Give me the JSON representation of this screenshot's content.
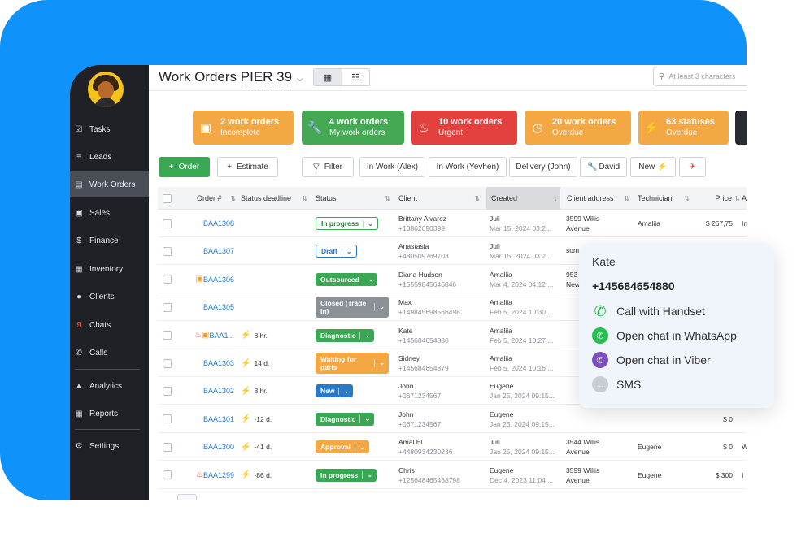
{
  "sidebar": {
    "items": [
      {
        "label": "Tasks",
        "icon": "clipboard-check-icon"
      },
      {
        "label": "Leads",
        "icon": "filter-lines-icon"
      },
      {
        "label": "Work Orders",
        "icon": "work-orders-icon"
      },
      {
        "label": "Sales",
        "icon": "cart-icon"
      },
      {
        "label": "Finance",
        "icon": "dollar-circle-icon"
      },
      {
        "label": "Inventory",
        "icon": "warehouse-icon"
      },
      {
        "label": "Clients",
        "icon": "users-icon"
      },
      {
        "label": "Chats",
        "icon": "chat-badge-icon",
        "badge": "9"
      },
      {
        "label": "Calls",
        "icon": "phone-icon"
      },
      {
        "label": "Analytics",
        "icon": "chart-area-icon"
      },
      {
        "label": "Reports",
        "icon": "grid-report-icon"
      },
      {
        "label": "Settings",
        "icon": "gear-icon"
      }
    ],
    "active": "Work Orders"
  },
  "header": {
    "title": "Work Orders",
    "location": "PIER 39",
    "search_placeholder": "At least 3 characters"
  },
  "cards": [
    {
      "title": "2 work orders",
      "subtitle": "Incomplete",
      "color": "#f4a844",
      "icon": "boxes-icon"
    },
    {
      "title": "4 work orders",
      "subtitle": "My work orders",
      "color": "#45a853",
      "icon": "wrench-icon"
    },
    {
      "title": "10 work orders",
      "subtitle": "Urgent",
      "color": "#e2413d",
      "icon": "flame-icon"
    },
    {
      "title": "20 work orders",
      "subtitle": "Overdue",
      "color": "#f4a844",
      "icon": "clock-icon"
    },
    {
      "title": "63 statuses",
      "subtitle": "Overdue",
      "color": "#f4a844",
      "icon": "bolt-icon"
    }
  ],
  "toolbar": {
    "order_label": "Order",
    "estimate_label": "Estimate",
    "filter_label": "Filter",
    "chips": [
      "In Work (Alex)",
      "In Work (Yevhen)",
      "Delivery (John)",
      "David",
      "New"
    ]
  },
  "table": {
    "headers": [
      "Order #",
      "Status deadline",
      "Status",
      "Client",
      "Created",
      "Client address",
      "Technician",
      "Price",
      "A"
    ],
    "rows": [
      {
        "order": "BAA1308",
        "deadline": "",
        "status": "In progress",
        "status_style": "outline",
        "client": "Brittany Alvarez",
        "phone": "+13862690399",
        "created_by": "Juli",
        "created": "Mar 15, 2024 03:2...",
        "addr1": "3599 Willis",
        "addr2": "Avenue",
        "tech": "Amaliia",
        "price": "$ 267,75",
        "extra": "In"
      },
      {
        "order": "BAA1307",
        "deadline": "",
        "status": "Draft",
        "status_style": "draft",
        "client": "Anastasia",
        "phone": "+480509769703",
        "created_by": "Juli",
        "created": "Mar 15, 2024 03:2...",
        "addr1": "som",
        "addr2": "",
        "tech": "",
        "price": "",
        "extra": ""
      },
      {
        "order": "BAA1306",
        "deadline": "",
        "status": "Outsourced",
        "status_style": "green",
        "client": "Diana Hudson",
        "phone": "+15559845646846",
        "created_by": "Amaliia",
        "created": "Mar 4, 2024 04:12 ...",
        "addr1": "953",
        "addr2": "New",
        "tech": "",
        "price": "",
        "extra": ""
      },
      {
        "order": "BAA1305",
        "deadline": "",
        "status": "Closed (Trade In)",
        "status_style": "grey",
        "client": "Max",
        "phone": "+149845698566498",
        "created_by": "Amaliia",
        "created": "Feb 5, 2024 10:30 ...",
        "addr1": "",
        "addr2": "",
        "tech": "",
        "price": "",
        "extra": ""
      },
      {
        "order": "BAA1...",
        "deadline": "8 hr.",
        "status": "Diagnostic",
        "status_style": "green",
        "client": "Kate",
        "phone": "+145684654880",
        "created_by": "Amaliia",
        "created": "Feb 5, 2024 10:27 ...",
        "addr1": "",
        "addr2": "",
        "tech": "",
        "price": "",
        "extra": ""
      },
      {
        "order": "BAA1303",
        "deadline": "14 d.",
        "status": "Waiting for parts",
        "status_style": "orange",
        "client": "Sidney",
        "phone": "+145684654879",
        "created_by": "Amaliia",
        "created": "Feb 5, 2024 10:16 ...",
        "addr1": "",
        "addr2": "",
        "tech": "",
        "price": "",
        "extra": ""
      },
      {
        "order": "BAA1302",
        "deadline": "8 hr.",
        "status": "New",
        "status_style": "blue",
        "client": "John",
        "phone": "+0671234567",
        "created_by": "Eugene",
        "created": "Jan 25, 2024 09:15...",
        "addr1": "",
        "addr2": "",
        "tech": "",
        "price": "",
        "extra": ""
      },
      {
        "order": "BAA1301",
        "deadline": "-12 d.",
        "status": "Diagnostic",
        "status_style": "green",
        "client": "John",
        "phone": "+0671234567",
        "created_by": "Eugene",
        "created": "Jan 25, 2024 09:15...",
        "addr1": "",
        "addr2": "",
        "tech": "",
        "price": "$ 0",
        "extra": ""
      },
      {
        "order": "BAA1300",
        "deadline": "-41 d.",
        "status": "Approval",
        "status_style": "orange",
        "client": "Amal El",
        "phone": "+4480934230236",
        "created_by": "Juli",
        "created": "Jan 25, 2024 09:15...",
        "addr1": "3544 Willis",
        "addr2": "Avenue",
        "tech": "Eugene",
        "price": "$ 0",
        "extra": "W"
      },
      {
        "order": "BAA1299",
        "deadline": "-86 d.",
        "status": "In progress",
        "status_style": "green",
        "client": "Chris",
        "phone": "+125648465468798",
        "created_by": "Eugene",
        "created": "Dec 4, 2023 11:04 ...",
        "addr1": "3599 Willis",
        "addr2": "Avenue",
        "tech": "Eugene",
        "price": "$ 300",
        "extra": "I"
      }
    ]
  },
  "popup": {
    "name": "Kate",
    "phone": "+145684654880",
    "actions": [
      {
        "label": "Call with Handset",
        "icon": "phone-green-icon",
        "color": "#2fb344"
      },
      {
        "label": "Open chat in WhatsApp",
        "icon": "whatsapp-icon",
        "color": "#25c050"
      },
      {
        "label": "Open chat in Viber",
        "icon": "viber-icon",
        "color": "#7b4fbf"
      },
      {
        "label": "SMS",
        "icon": "sms-icon",
        "color": "#b9bec5"
      }
    ]
  },
  "colors": {
    "background_blue": "#0f93fb",
    "sidebar": "#1f2126",
    "green": "#3aa754",
    "orange": "#f4a844",
    "red": "#e2413d",
    "link": "#2979c6"
  }
}
